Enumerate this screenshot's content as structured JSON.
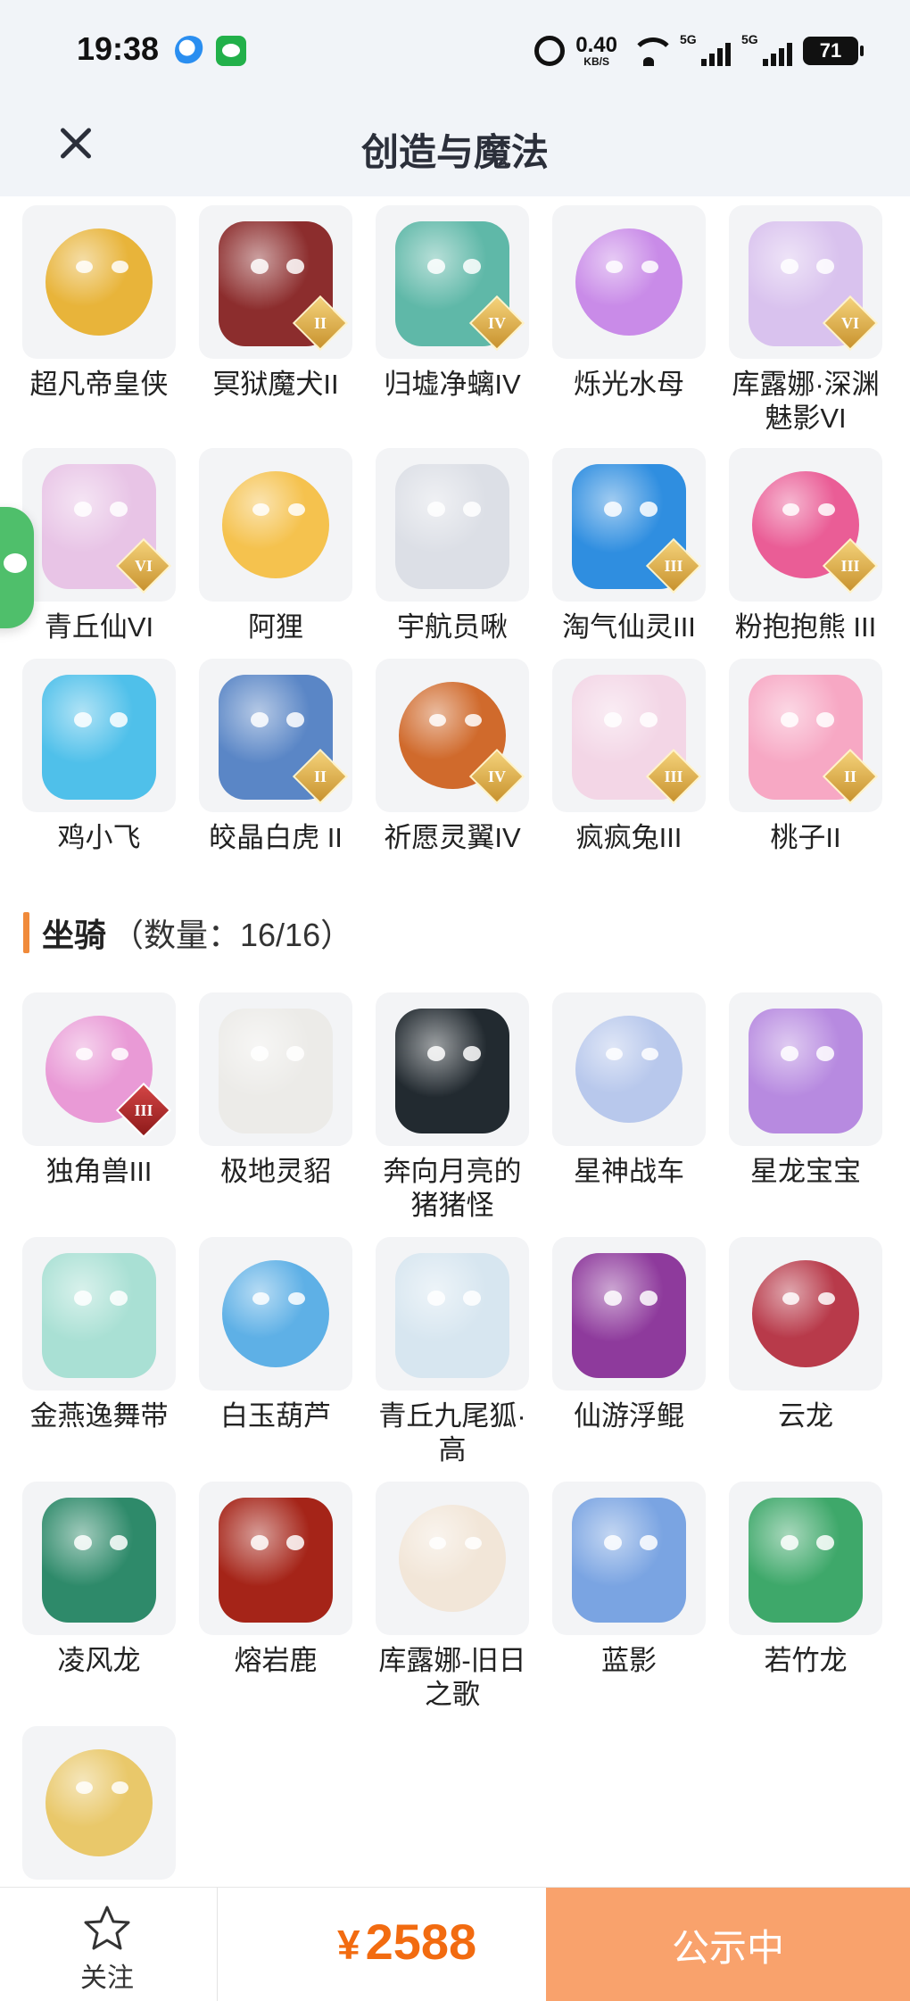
{
  "status_bar": {
    "time": "19:38",
    "speed_value": "0.40",
    "speed_unit": "KB/S",
    "signal1_label": "5G",
    "signal2_label": "5G",
    "battery": "71"
  },
  "header": {
    "title": "创造与魔法"
  },
  "pets": [
    {
      "name": "超凡帝皇侠",
      "badge": "",
      "color": "#e8b43a"
    },
    {
      "name": "冥狱魔犬II",
      "badge": "II",
      "color": "#8c2d2d"
    },
    {
      "name": "归墟净螭IV",
      "badge": "IV",
      "color": "#5fb8a8"
    },
    {
      "name": "烁光水母",
      "badge": "",
      "color": "#c98be8"
    },
    {
      "name": "库露娜·深渊魅影VI",
      "badge": "VI",
      "color": "#d9c2ee"
    },
    {
      "name": "青丘仙VI",
      "badge": "VI",
      "color": "#e8c4e6"
    },
    {
      "name": "阿狸",
      "badge": "",
      "color": "#f5c24e"
    },
    {
      "name": "宇航员啾",
      "badge": "",
      "color": "#dcdfe6"
    },
    {
      "name": "淘气仙灵III",
      "badge": "III",
      "color": "#2f8ee0"
    },
    {
      "name": "粉抱抱熊 III",
      "badge": "III",
      "color": "#ea5d96"
    },
    {
      "name": "鸡小飞",
      "badge": "",
      "color": "#4fc0ea"
    },
    {
      "name": "皎晶白虎 II",
      "badge": "II",
      "color": "#5a86c6"
    },
    {
      "name": "祈愿灵翼IV",
      "badge": "IV",
      "color": "#d06a2c"
    },
    {
      "name": "疯疯兔III",
      "badge": "III",
      "color": "#f3d6e6"
    },
    {
      "name": "桃子II",
      "badge": "II",
      "color": "#f7a8c4"
    }
  ],
  "mounts_section": {
    "title": "坐骑",
    "count": "（数量：16/16）"
  },
  "mounts": [
    {
      "name": "独角兽III",
      "badge": "III",
      "badge_style": "red",
      "color": "#e99ad6"
    },
    {
      "name": "极地灵貂",
      "badge": "",
      "color": "#ecebe8"
    },
    {
      "name": "奔向月亮的猪猪怪",
      "badge": "",
      "color": "#222a30"
    },
    {
      "name": "星神战车",
      "badge": "",
      "color": "#b8c8ec"
    },
    {
      "name": "星龙宝宝",
      "badge": "",
      "color": "#b78ae0"
    },
    {
      "name": "金燕逸舞带",
      "badge": "",
      "color": "#a9e0d4"
    },
    {
      "name": "白玉葫芦",
      "badge": "",
      "color": "#5eb0e6"
    },
    {
      "name": "青丘九尾狐·高",
      "badge": "",
      "color": "#d7e6f0"
    },
    {
      "name": "仙游浮鲲",
      "badge": "",
      "color": "#8e3a9c"
    },
    {
      "name": "云龙",
      "badge": "",
      "color": "#b83a4a"
    },
    {
      "name": "凌风龙",
      "badge": "",
      "color": "#2e8a6a"
    },
    {
      "name": "熔岩鹿",
      "badge": "",
      "color": "#a52418"
    },
    {
      "name": "库露娜-旧日之歌",
      "badge": "",
      "color": "#f2e6d8"
    },
    {
      "name": "蓝影",
      "badge": "",
      "color": "#7aa4e2"
    },
    {
      "name": "若竹龙",
      "badge": "",
      "color": "#3ea86a"
    },
    {
      "name": "",
      "badge": "",
      "color": "#e9c86a"
    }
  ],
  "bottom_bar": {
    "follow_label": "关注",
    "currency": "¥",
    "price": "2588",
    "status_label": "公示中"
  },
  "colors": {
    "accent": "#f08a3a",
    "price": "#f26b10",
    "status_button": "#f9a26c"
  }
}
